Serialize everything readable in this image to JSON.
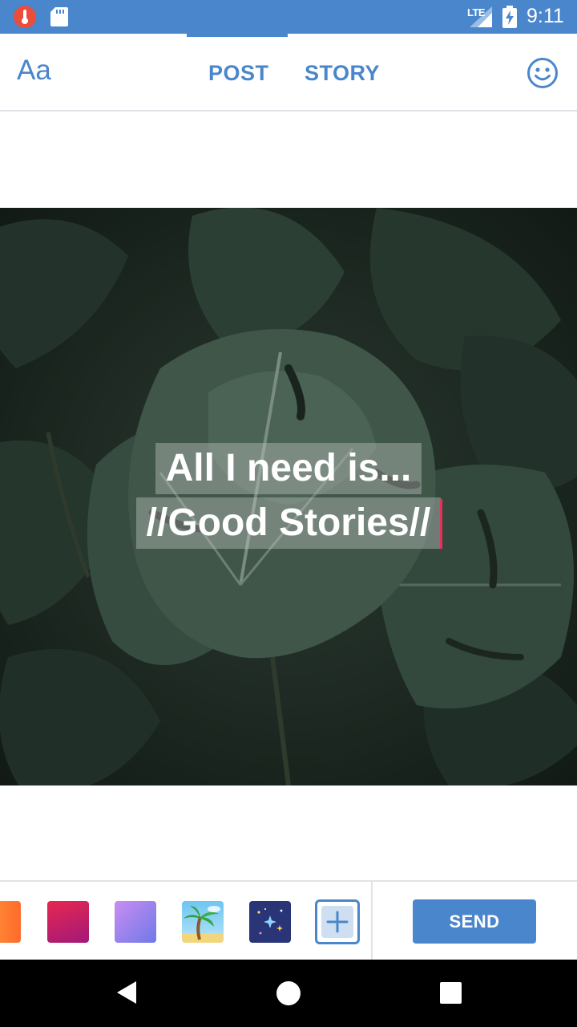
{
  "status_bar": {
    "time": "9:11",
    "network": "LTE",
    "icons": [
      "thermometer-notification-icon",
      "sd-card-icon",
      "lte-signal-icon",
      "battery-charging-icon"
    ]
  },
  "header": {
    "font_button_label": "Aa",
    "tabs": [
      {
        "label": "POST",
        "selected": true
      },
      {
        "label": "STORY",
        "selected": false
      }
    ],
    "emoji_icon": "smiley-icon"
  },
  "canvas": {
    "background": "monstera-leaves-photo",
    "text_lines": [
      "All I need is...",
      "//Good Stories//"
    ]
  },
  "backgrounds": {
    "swatches": [
      {
        "name": "orange-gradient",
        "colors": [
          "#ff9a3a",
          "#ff6b2c"
        ]
      },
      {
        "name": "pink-gradient",
        "colors": [
          "#e72850",
          "#a21878"
        ]
      },
      {
        "name": "purple-gradient",
        "colors": [
          "#c98df2",
          "#6f79e8"
        ]
      },
      {
        "name": "palm-tree-image",
        "colors": [
          "#6ec5f2",
          "#b6e4f8"
        ]
      },
      {
        "name": "starry-night-image",
        "colors": [
          "#2a3577"
        ]
      }
    ],
    "add_icon": "plus-icon"
  },
  "actions": {
    "send_label": "SEND"
  },
  "colors": {
    "accent": "#4a86cc",
    "caret": "#e8305a",
    "status_bar": "#4a86cc"
  },
  "nav_bar": {
    "icons": [
      "back-triangle-icon",
      "home-circle-icon",
      "recents-square-icon"
    ]
  }
}
